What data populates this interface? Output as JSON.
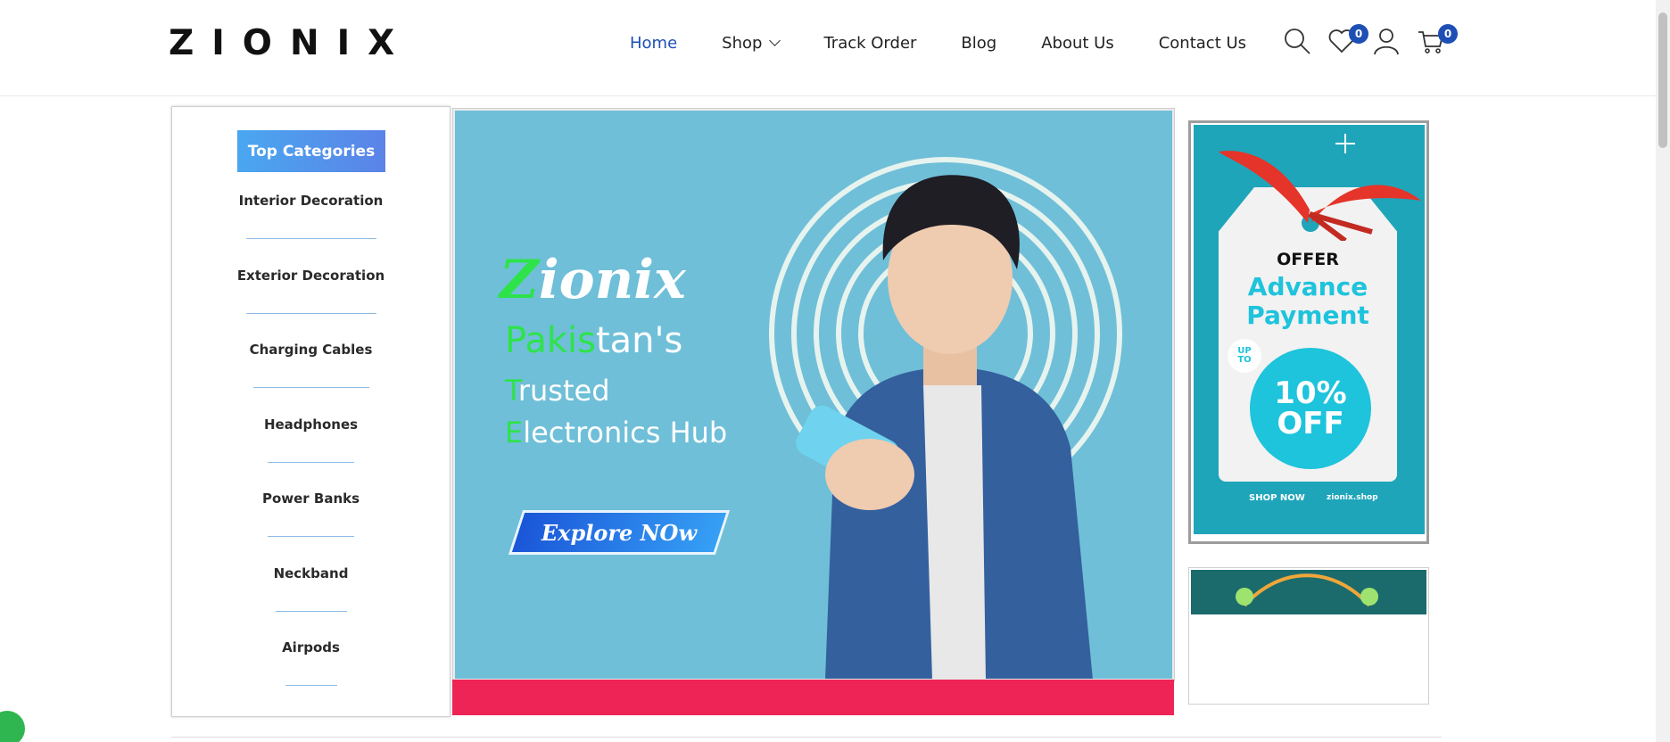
{
  "header": {
    "logo": "ZIONIX",
    "nav": [
      {
        "label": "Home",
        "active": true
      },
      {
        "label": "Shop",
        "dropdown": true
      },
      {
        "label": "Track Order"
      },
      {
        "label": "Blog"
      },
      {
        "label": "About Us"
      },
      {
        "label": "Contact Us"
      }
    ],
    "wishlist_count": "0",
    "cart_count": "0"
  },
  "sidebar": {
    "title": "Top Categories",
    "items": [
      {
        "label": "Interior Decoration"
      },
      {
        "label": "Exterior Decoration"
      },
      {
        "label": "Charging Cables"
      },
      {
        "label": "Headphones"
      },
      {
        "label": "Power Banks"
      },
      {
        "label": "Neckband"
      },
      {
        "label": "Airpods"
      }
    ]
  },
  "hero": {
    "brand_first": "Z",
    "brand_rest": "ionix",
    "line1_green": "Pakis",
    "line1_rest": "tan's",
    "line2_green": "T",
    "line2_rest": "rusted",
    "line3_green": "E",
    "line3_rest": "lectronics Hub",
    "cta": "Explore NOw"
  },
  "promo": {
    "offer": "OFFER",
    "line1": "Advance",
    "line2": "Payment",
    "upto_1": "UP",
    "upto_2": "TO",
    "pct": "10%",
    "off": "OFF",
    "shop_now": "SHOP NOW",
    "url": "zionix.shop"
  },
  "colors": {
    "accent": "#1e4fb4",
    "hero_bg": "#6fbfd8",
    "green": "#2ee34a",
    "strip": "#ee2456",
    "promo_bg": "#1fa5ba"
  }
}
